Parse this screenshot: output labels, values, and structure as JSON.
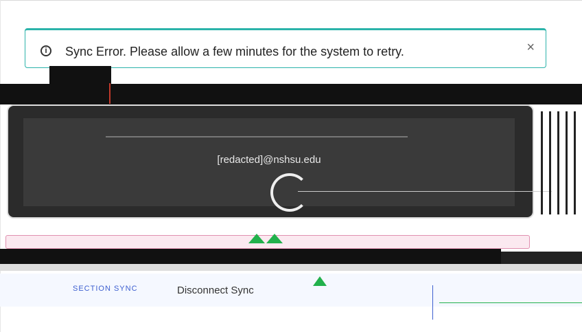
{
  "alert": {
    "icon": "info-circle-icon",
    "message": "Sync Error. Please allow a few minutes for the system to retry.",
    "close_label": "×",
    "accent_color": "#2bb3aa"
  },
  "account": {
    "email": "[redacted]@nshsu.edu",
    "status_icon": "loading-spinner-icon"
  },
  "actions": {
    "section_label": "SECTION SYNC",
    "disconnect_label": "Disconnect Sync"
  },
  "colors": {
    "success": "#22b14c",
    "link": "#3d5fd0",
    "error_border": "#e090b0"
  }
}
